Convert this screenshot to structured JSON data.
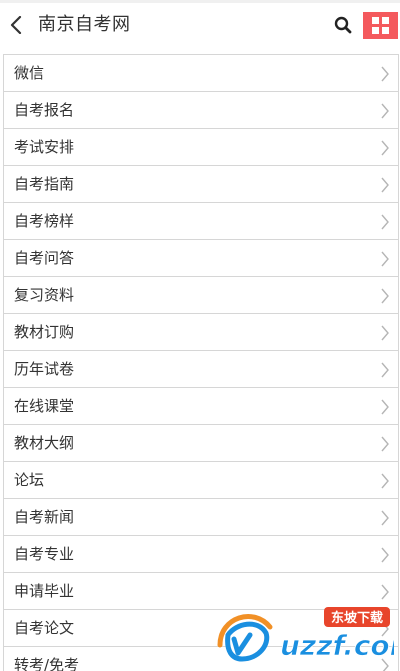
{
  "header": {
    "title": "南京自考网",
    "back_icon": "chevron-left-icon",
    "search_icon": "search-icon",
    "menu_icon": "grid-icon",
    "menu_color": "#f4595d"
  },
  "menu_items": [
    {
      "label": "微信"
    },
    {
      "label": "自考报名"
    },
    {
      "label": "考试安排"
    },
    {
      "label": "自考指南"
    },
    {
      "label": "自考榜样"
    },
    {
      "label": "自考问答"
    },
    {
      "label": "复习资料"
    },
    {
      "label": "教材订购"
    },
    {
      "label": "历年试卷"
    },
    {
      "label": "在线课堂"
    },
    {
      "label": "教材大纲"
    },
    {
      "label": "论坛"
    },
    {
      "label": "自考新闻"
    },
    {
      "label": "自考专业"
    },
    {
      "label": "申请毕业"
    },
    {
      "label": "自考论文"
    },
    {
      "label": "转考/免考"
    }
  ],
  "watermark": {
    "brand": "uzzf.com",
    "badge": "东坡下载",
    "color": "#1a8fe0"
  }
}
